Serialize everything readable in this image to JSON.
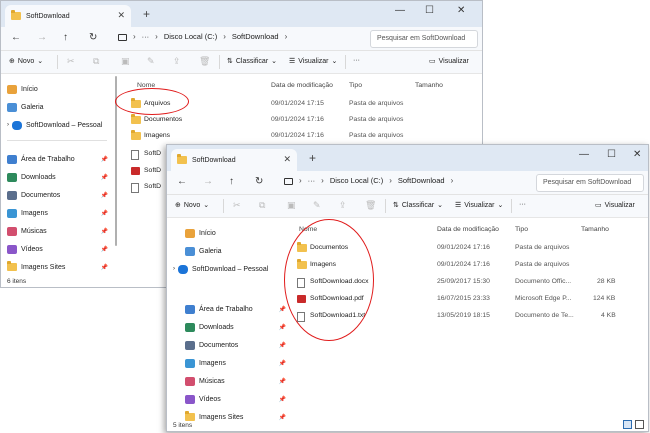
{
  "window1": {
    "tab_title": "SoftDownload",
    "breadcrumb": [
      "Disco Local (C:)",
      "SoftDownload"
    ],
    "search_placeholder": "Pesquisar em SoftDownload",
    "toolbar": {
      "new": "Novo",
      "sort": "Classificar",
      "view": "Visualizar",
      "more": "···",
      "details": "Visualizar"
    },
    "nav": [
      "Início",
      "Galeria",
      "SoftDownload – Pessoal",
      "Área de Trabalho",
      "Downloads",
      "Documentos",
      "Imagens",
      "Músicas",
      "Vídeos",
      "Imagens Sites"
    ],
    "columns": [
      "Nome",
      "Data de modificação",
      "Tipo",
      "Tamanho"
    ],
    "files": [
      {
        "name": "Arquivos",
        "date": "09/01/2024 17:15",
        "type": "Pasta de arquivos",
        "size": ""
      },
      {
        "name": "Documentos",
        "date": "09/01/2024 17:16",
        "type": "Pasta de arquivos",
        "size": ""
      },
      {
        "name": "Imagens",
        "date": "09/01/2024 17:16",
        "type": "Pasta de arquivos",
        "size": ""
      },
      {
        "name": "SoftD",
        "date": "",
        "type": "",
        "size": ""
      },
      {
        "name": "SoftD",
        "date": "",
        "type": "",
        "size": ""
      },
      {
        "name": "SoftD",
        "date": "",
        "type": "",
        "size": ""
      }
    ],
    "status": "6 itens"
  },
  "window2": {
    "tab_title": "SoftDownload",
    "breadcrumb": [
      "Disco Local (C:)",
      "SoftDownload"
    ],
    "search_placeholder": "Pesquisar em SoftDownload",
    "toolbar": {
      "new": "Novo",
      "sort": "Classificar",
      "view": "Visualizar",
      "more": "···",
      "details": "Visualizar"
    },
    "nav": [
      "Início",
      "Galeria",
      "SoftDownload – Pessoal",
      "Área de Trabalho",
      "Downloads",
      "Documentos",
      "Imagens",
      "Músicas",
      "Vídeos",
      "Imagens Sites"
    ],
    "columns": [
      "Nome",
      "Data de modificação",
      "Tipo",
      "Tamanho"
    ],
    "files": [
      {
        "name": "Documentos",
        "date": "09/01/2024 17:16",
        "type": "Pasta de arquivos",
        "size": ""
      },
      {
        "name": "Imagens",
        "date": "09/01/2024 17:16",
        "type": "Pasta de arquivos",
        "size": ""
      },
      {
        "name": "SoftDownload.docx",
        "date": "25/09/2017 15:30",
        "type": "Documento Offic...",
        "size": "28 KB"
      },
      {
        "name": "SoftDownload.pdf",
        "date": "16/07/2015 23:33",
        "type": "Microsoft Edge P...",
        "size": "124 KB"
      },
      {
        "name": "SoftDownload1.txt",
        "date": "13/05/2019 18:15",
        "type": "Documento de Te...",
        "size": "4 KB"
      }
    ],
    "status": "5 itens"
  },
  "colors": {
    "folder": "#f2c14e",
    "highlight_ring": "#e01b1b",
    "titlebar": "#dfe8f3"
  }
}
